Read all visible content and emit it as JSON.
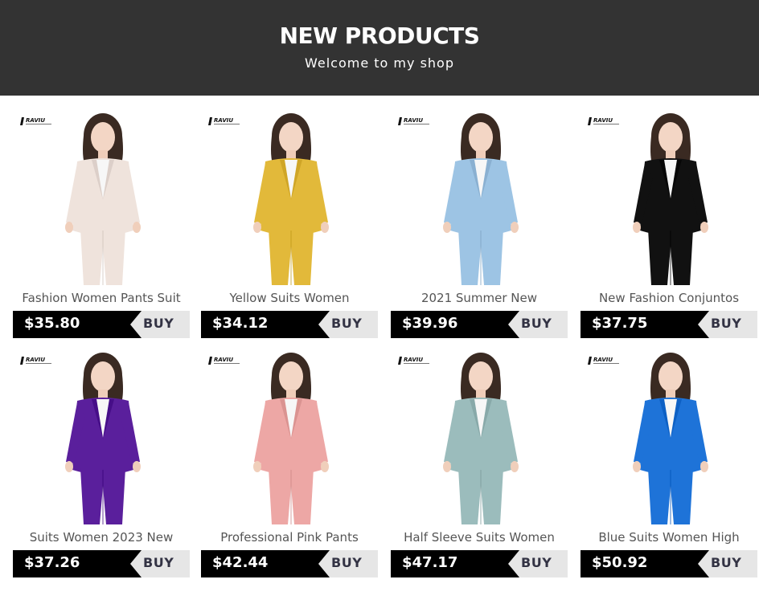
{
  "header": {
    "title": "NEW PRODUCTS",
    "subtitle": "Welcome to my shop"
  },
  "brand_logo_text": "RAVIU",
  "buy_label": "BUY",
  "colors": {
    "header_bg": "#333333",
    "price_bar": "#000000",
    "buy_tab": "#e6e6e6",
    "accent_text": "#333344"
  },
  "products": [
    {
      "name": "Fashion Women Pants Suit",
      "price": "$35.80",
      "outfit_color": "#efe3dc"
    },
    {
      "name": "Yellow Suits Women",
      "price": "$34.12",
      "outfit_color": "#e2b93a"
    },
    {
      "name": "2021 Summer New",
      "price": "$39.96",
      "outfit_color": "#9dc4e4"
    },
    {
      "name": "New Fashion Conjuntos",
      "price": "$37.75",
      "outfit_color": "#111111"
    },
    {
      "name": "Suits Women 2023 New",
      "price": "$37.26",
      "outfit_color": "#5a1f9c"
    },
    {
      "name": "Professional Pink Pants",
      "price": "$42.44",
      "outfit_color": "#eda7a5"
    },
    {
      "name": "Half Sleeve Suits Women",
      "price": "$47.17",
      "outfit_color": "#9bbcbc"
    },
    {
      "name": "Blue Suits Women High",
      "price": "$50.92",
      "outfit_color": "#1e73d8"
    }
  ]
}
